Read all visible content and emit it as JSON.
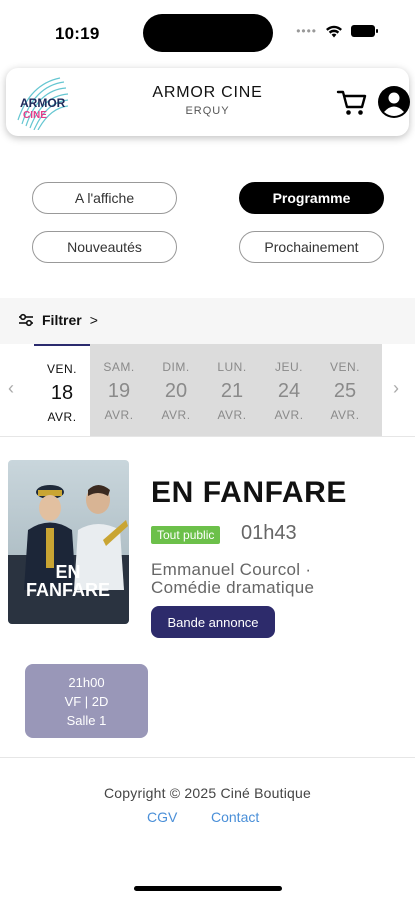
{
  "status_bar": {
    "time": "10:19",
    "signal_dots": "••••"
  },
  "header": {
    "title": "ARMOR CINE",
    "subtitle": "ERQUY",
    "logo_text_top": "ARMOR",
    "logo_text_bottom": "CINE"
  },
  "nav": {
    "a_laffiche": "A l'affiche",
    "programme": "Programme",
    "nouveautes": "Nouveautés",
    "prochainement": "Prochainement",
    "active": "Programme"
  },
  "filter": {
    "label": "Filtrer",
    "chevron": ">"
  },
  "dates": [
    {
      "dow": "VEN.",
      "day": "18",
      "month": "AVR.",
      "selected": true
    },
    {
      "dow": "SAM.",
      "day": "19",
      "month": "AVR.",
      "selected": false
    },
    {
      "dow": "DIM.",
      "day": "20",
      "month": "AVR.",
      "selected": false
    },
    {
      "dow": "LUN.",
      "day": "21",
      "month": "AVR.",
      "selected": false
    },
    {
      "dow": "JEU.",
      "day": "24",
      "month": "AVR.",
      "selected": false
    },
    {
      "dow": "VEN.",
      "day": "25",
      "month": "AVR.",
      "selected": false
    }
  ],
  "date_arrows": {
    "prev": "‹",
    "next": "›"
  },
  "movie": {
    "title": "EN FANFARE",
    "rating": "Tout public",
    "duration": "01h43",
    "director": "Emmanuel Courcol ·",
    "genre": "Comédie dramatique",
    "trailer_label": "Bande annonce",
    "poster_title_line1": "EN",
    "poster_title_line2": "FANFARE"
  },
  "showtimes": [
    {
      "time": "21h00",
      "format": "VF | 2D",
      "room": "Salle 1"
    }
  ],
  "footer": {
    "copyright": "Copyright © 2025 Ciné Boutique",
    "cgv": "CGV",
    "contact": "Contact"
  },
  "colors": {
    "accent": "#2d2b6b",
    "rating_green": "#6cc04a",
    "showtime_bg": "#9997b8",
    "link": "#4a8fd8"
  },
  "icons": [
    "wifi-icon",
    "battery-icon",
    "cart-icon",
    "user-icon",
    "filter-icon"
  ]
}
